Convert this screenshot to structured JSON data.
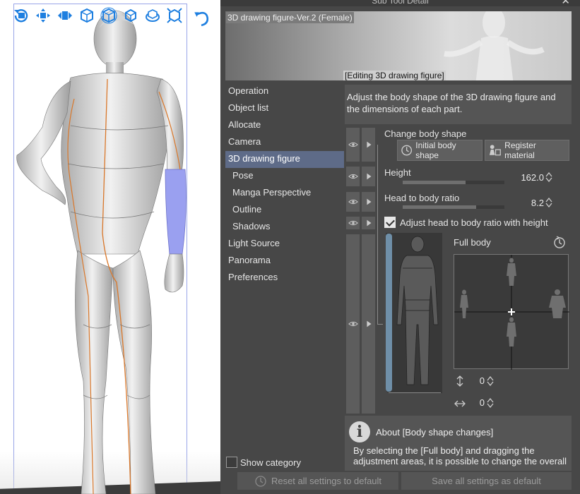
{
  "window": {
    "title": "Sub Tool Detail",
    "close_glyph": "✕"
  },
  "canvas": {
    "tools": [
      "camera-rotate-icon",
      "camera-pan-icon",
      "camera-move-icon",
      "object-rotate-icon",
      "object-rotate-alt-icon",
      "object-rotate-3d-icon",
      "object-pan-icon",
      "object-move-icon"
    ],
    "undo_icon": "undo-icon",
    "accent": "#1e7fe0"
  },
  "preview": {
    "name": "3D drawing figure-Ver.2 (Female)",
    "editing_label": "[Editing 3D drawing figure]"
  },
  "categories": [
    {
      "label": "Operation",
      "sub": false,
      "active": false
    },
    {
      "label": "Object list",
      "sub": false,
      "active": false
    },
    {
      "label": "Allocate",
      "sub": false,
      "active": false
    },
    {
      "label": "Camera",
      "sub": false,
      "active": false
    },
    {
      "label": "3D drawing figure",
      "sub": false,
      "active": true
    },
    {
      "label": "Pose",
      "sub": true,
      "active": false
    },
    {
      "label": "Manga Perspective",
      "sub": true,
      "active": false
    },
    {
      "label": "Outline",
      "sub": true,
      "active": false
    },
    {
      "label": "Shadows",
      "sub": true,
      "active": false
    },
    {
      "label": "Light Source",
      "sub": false,
      "active": false
    },
    {
      "label": "Panorama",
      "sub": false,
      "active": false
    },
    {
      "label": "Preferences",
      "sub": false,
      "active": false
    }
  ],
  "description": "Adjust the body shape of the 3D drawing figure and the dimensions of each part.",
  "body_shape": {
    "heading": "Change body shape",
    "initial_btn": "Initial body shape",
    "register_btn": "Register material"
  },
  "height": {
    "label": "Height",
    "value": "162.0",
    "fraction": 0.62
  },
  "ratio": {
    "label": "Head to body ratio",
    "value": "8.2",
    "fraction": 0.72
  },
  "adjust_ratio": {
    "label": "Adjust head to body ratio with height",
    "checked": true
  },
  "full_body": {
    "label": "Full body"
  },
  "offsets": {
    "vertical": "0",
    "horizontal": "0"
  },
  "about": {
    "icon": "i",
    "title": "About [Body shape changes]",
    "body": "By selecting the [Full body] and dragging the adjustment areas, it is possible to change the overall"
  },
  "show_category": {
    "label": "Show category",
    "checked": false
  },
  "footer": {
    "reset": "Reset all settings to default",
    "save": "Save all settings as default"
  },
  "colors": {
    "panel_bg": "#474747",
    "active_item": "#5e6b88",
    "slider_fill": "#6f6f6f",
    "body_bar": "#6f8fa8"
  }
}
